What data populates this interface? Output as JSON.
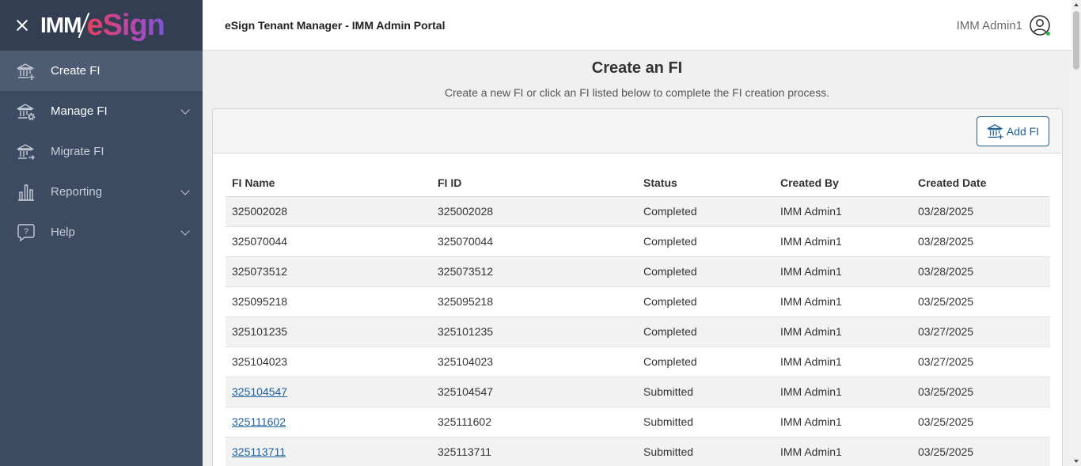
{
  "sidebar": {
    "logo_imm": "IMM",
    "logo_esign": "eSign",
    "items": [
      {
        "label": "Create FI",
        "icon": "bank-plus-icon"
      },
      {
        "label": "Manage FI",
        "icon": "bank-gear-icon"
      },
      {
        "label": "Migrate FI",
        "icon": "bank-arrow-icon"
      },
      {
        "label": "Reporting",
        "icon": "bar-chart-icon"
      },
      {
        "label": "Help",
        "icon": "help-bubble-icon"
      }
    ]
  },
  "header": {
    "title": "eSign Tenant Manager - IMM Admin Portal",
    "user_name": "IMM Admin1"
  },
  "main": {
    "title": "Create an FI",
    "subtitle": "Create a new FI or click an FI listed below to complete the FI creation process.",
    "add_button_label": "Add FI"
  },
  "table": {
    "columns": [
      "FI Name",
      "FI ID",
      "Status",
      "Created By",
      "Created Date"
    ],
    "rows": [
      {
        "fi_name": "325002028",
        "fi_id": "325002028",
        "status": "Completed",
        "created_by": "IMM Admin1",
        "created_date": "03/28/2025"
      },
      {
        "fi_name": "325070044",
        "fi_id": "325070044",
        "status": "Completed",
        "created_by": "IMM Admin1",
        "created_date": "03/28/2025"
      },
      {
        "fi_name": "325073512",
        "fi_id": "325073512",
        "status": "Completed",
        "created_by": "IMM Admin1",
        "created_date": "03/28/2025"
      },
      {
        "fi_name": "325095218",
        "fi_id": "325095218",
        "status": "Completed",
        "created_by": "IMM Admin1",
        "created_date": "03/25/2025"
      },
      {
        "fi_name": "325101235",
        "fi_id": "325101235",
        "status": "Completed",
        "created_by": "IMM Admin1",
        "created_date": "03/27/2025"
      },
      {
        "fi_name": "325104023",
        "fi_id": "325104023",
        "status": "Completed",
        "created_by": "IMM Admin1",
        "created_date": "03/27/2025"
      },
      {
        "fi_name": "325104547",
        "fi_id": "325104547",
        "status": "Submitted",
        "created_by": "IMM Admin1",
        "created_date": "03/25/2025"
      },
      {
        "fi_name": "325111602",
        "fi_id": "325111602",
        "status": "Submitted",
        "created_by": "IMM Admin1",
        "created_date": "03/25/2025"
      },
      {
        "fi_name": "325113711",
        "fi_id": "325113711",
        "status": "Submitted",
        "created_by": "IMM Admin1",
        "created_date": "03/25/2025"
      }
    ]
  },
  "colors": {
    "sidebar_bg": "#3c4a62",
    "sidebar_header_bg": "#333e52",
    "sidebar_active_bg": "#4d5b73",
    "link": "#1a5fa0",
    "button_border": "#1f5f8f",
    "online_dot": "#2db84d"
  }
}
